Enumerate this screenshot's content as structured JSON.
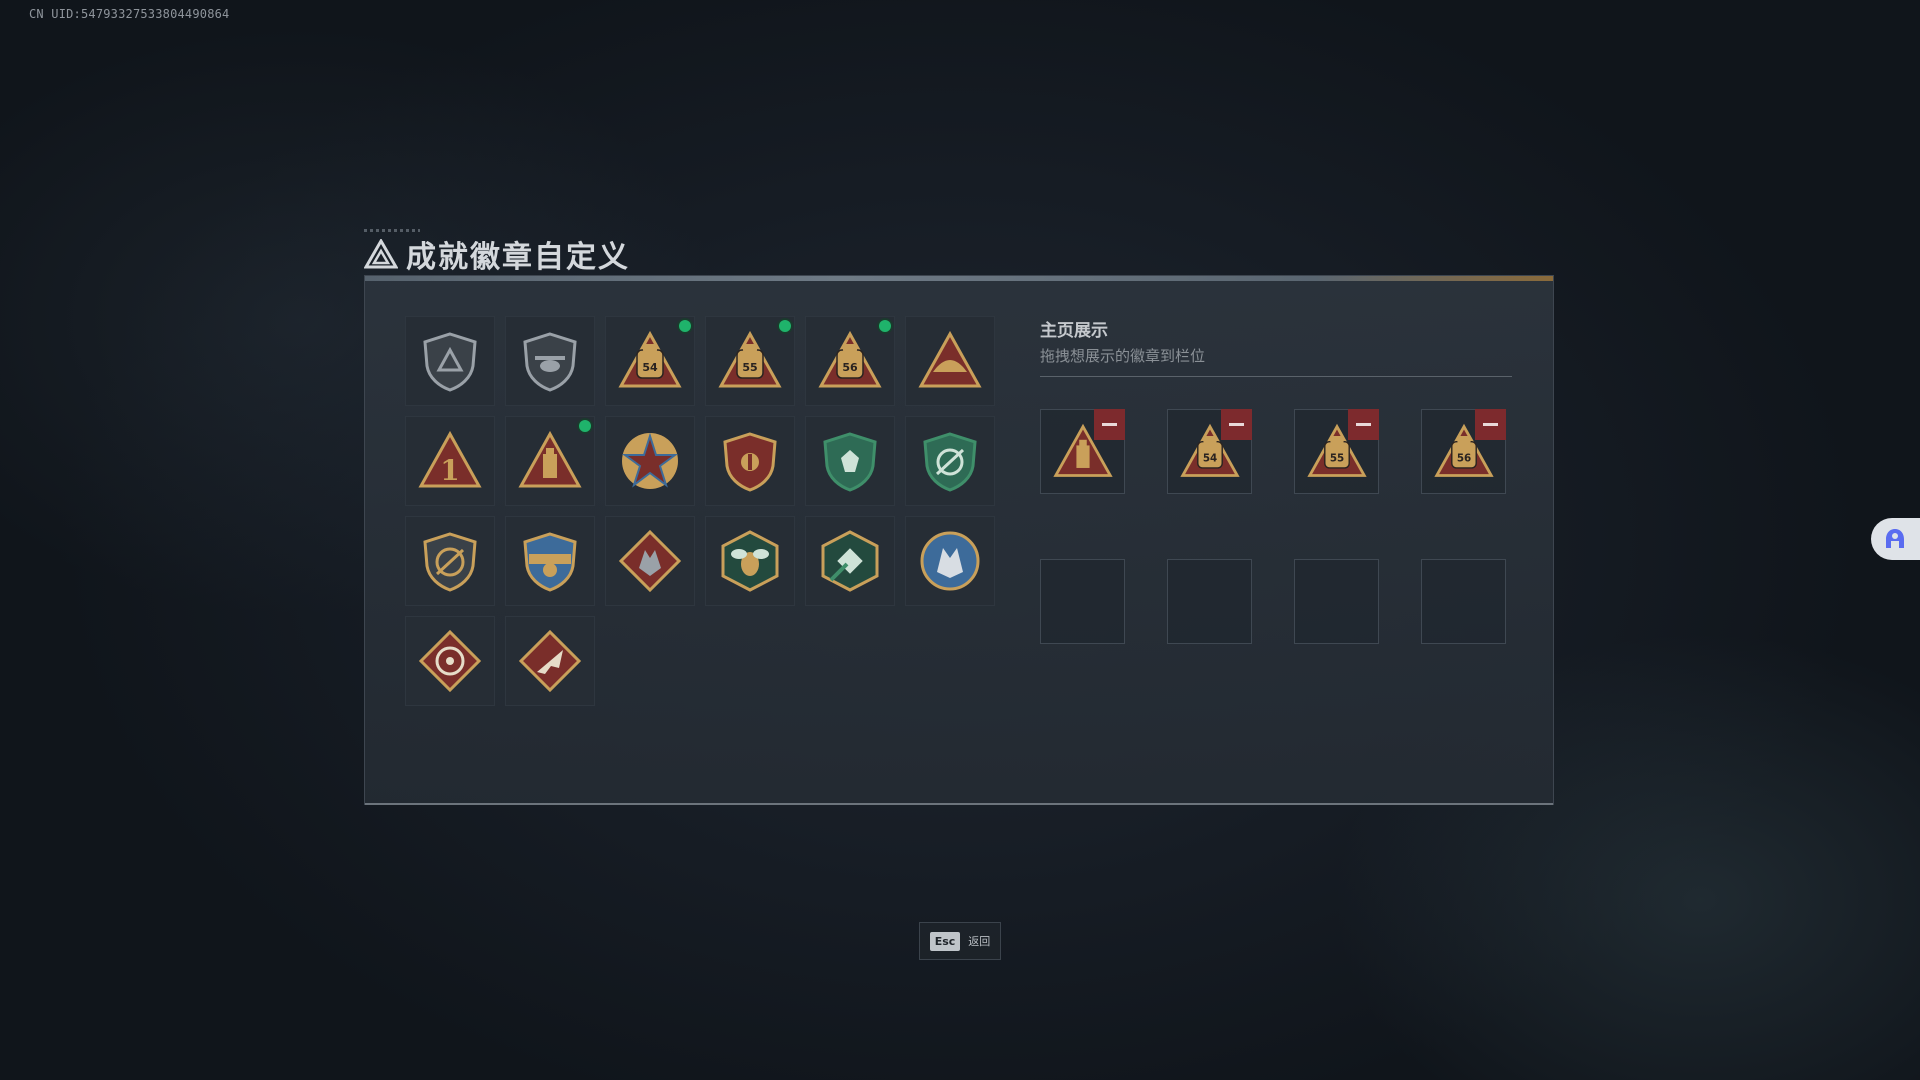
{
  "uid_text": "CN UID:547933275338044908​64",
  "title": "成就徽章自定义",
  "showcase": {
    "title": "主页展示",
    "subtitle": "拖拽想展示的徽章到栏位"
  },
  "footer": {
    "key": "Esc",
    "label": "返回"
  },
  "colors": {
    "new_dot": "#1fb36b",
    "remove": "#7d2a2d",
    "gold": "#c9a05a",
    "green": "#3f8f6a"
  },
  "badges": [
    {
      "icon": "gray-shield-emblem",
      "new": false
    },
    {
      "icon": "gray-helicopter-shield",
      "new": false
    },
    {
      "icon": "gold-pack-54",
      "new": true
    },
    {
      "icon": "gold-pack-55",
      "new": true
    },
    {
      "icon": "gold-pack-56",
      "new": true
    },
    {
      "icon": "gold-hat-triangle",
      "new": false
    },
    {
      "icon": "gold-triangle-1",
      "new": false
    },
    {
      "icon": "gold-triangle-bottle",
      "new": true
    },
    {
      "icon": "gold-star-compass",
      "new": false
    },
    {
      "icon": "gold-shield-wings",
      "new": false
    },
    {
      "icon": "green-shield-crest",
      "new": false
    },
    {
      "icon": "green-shield-target",
      "new": false
    },
    {
      "icon": "gray-shield-rifle",
      "new": false
    },
    {
      "icon": "gold-shield-blue",
      "new": false
    },
    {
      "icon": "red-diamond-wolf",
      "new": false
    },
    {
      "icon": "green-hex-bee",
      "new": false
    },
    {
      "icon": "green-hex-drone",
      "new": false
    },
    {
      "icon": "blue-circle-beast",
      "new": false
    },
    {
      "icon": "red-diamond-wheel",
      "new": false
    },
    {
      "icon": "red-diamond-plane",
      "new": false
    }
  ],
  "slots": [
    {
      "icon": "gold-triangle-bottle",
      "filled": true
    },
    {
      "icon": "gold-pack-54",
      "filled": true
    },
    {
      "icon": "gold-pack-55",
      "filled": true
    },
    {
      "icon": "gold-pack-56",
      "filled": true
    },
    {
      "filled": false
    },
    {
      "filled": false
    },
    {
      "filled": false
    },
    {
      "filled": false
    }
  ]
}
